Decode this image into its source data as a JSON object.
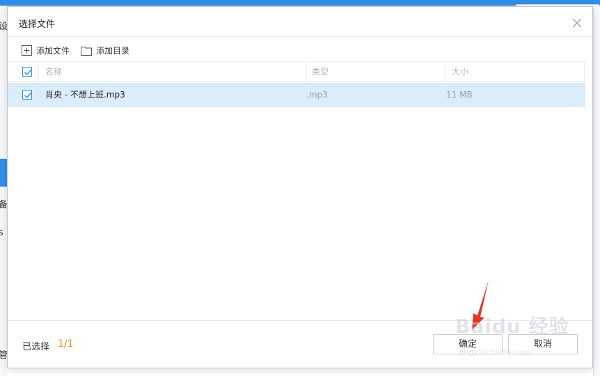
{
  "background": {
    "left_chars": [
      "设",
      "备",
      "s",
      "管"
    ]
  },
  "dialog": {
    "title": "选择文件",
    "toolbar": {
      "add_file": "添加文件",
      "add_folder": "添加目录"
    },
    "table": {
      "columns": [
        "名称",
        "类型",
        "大小"
      ],
      "rows": [
        {
          "name": "肖央 - 不想上班.mp3",
          "type": ".mp3",
          "size": "11 MB",
          "checked": true
        }
      ],
      "header_checked": true
    },
    "footer": {
      "selected_label": "已选择",
      "selected_count": "1/1",
      "confirm_label": "确定",
      "cancel_label": "取消"
    }
  },
  "watermark": {
    "logo": "Baidu 经验",
    "sub": "jingyan.baidu.com"
  },
  "colors": {
    "accent": "#2f8fe6",
    "row_selected": "#dbecfb",
    "count": "#f08a24",
    "arrow": "#e8332b"
  }
}
